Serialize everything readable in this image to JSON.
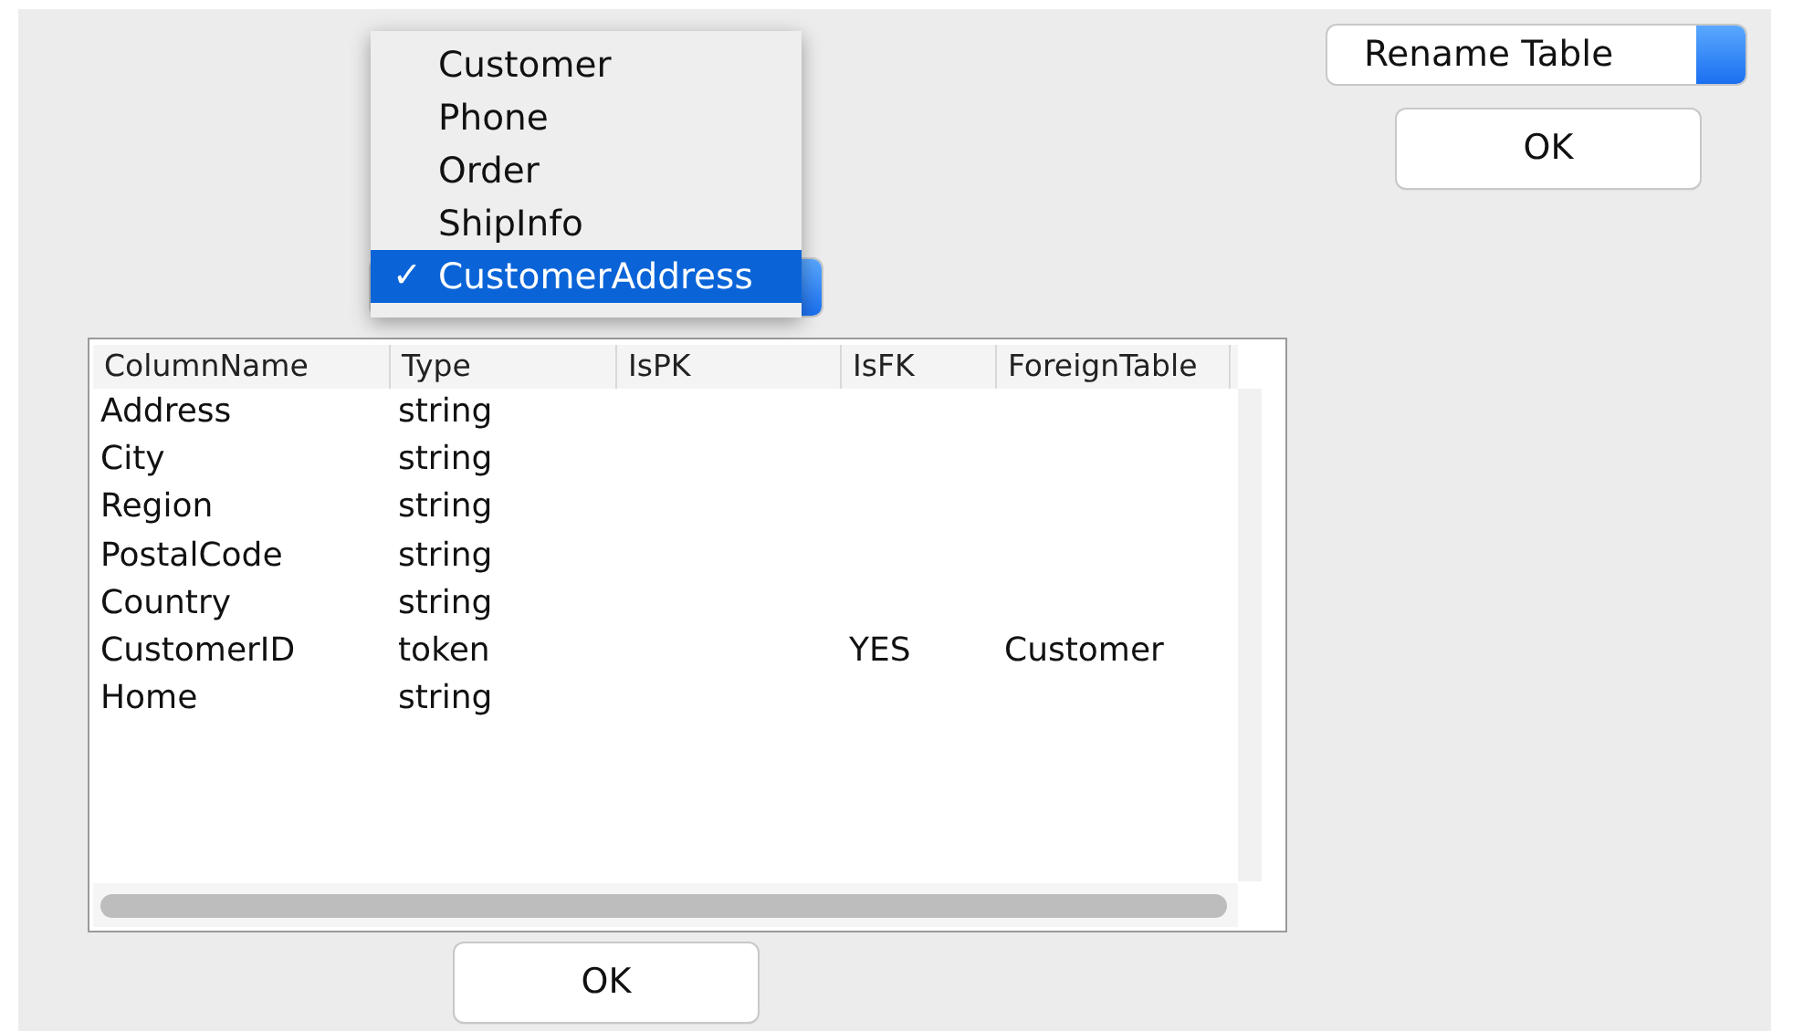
{
  "table_picker": {
    "options": [
      {
        "label": "Customer",
        "selected": false
      },
      {
        "label": "Phone",
        "selected": false
      },
      {
        "label": "Order",
        "selected": false
      },
      {
        "label": "ShipInfo",
        "selected": false
      },
      {
        "label": "CustomerAddress",
        "selected": true
      }
    ],
    "check_mark": "✓"
  },
  "action_select": {
    "value": "Rename Table"
  },
  "action_ok_button": "OK",
  "table": {
    "columns": [
      "ColumnName",
      "Type",
      "IsPK",
      "IsFK",
      "ForeignTable"
    ],
    "rows": [
      [
        "Address",
        "string",
        "",
        "",
        ""
      ],
      [
        "City",
        "string",
        "",
        "",
        ""
      ],
      [
        "Region",
        "string",
        "",
        "",
        ""
      ],
      [
        "PostalCode",
        "string",
        "",
        "",
        ""
      ],
      [
        "Country",
        "string",
        "",
        "",
        ""
      ],
      [
        "CustomerID",
        "token",
        "",
        "YES",
        "Customer"
      ],
      [
        "Home",
        "string",
        "",
        "",
        ""
      ]
    ]
  },
  "ok_button": "OK"
}
